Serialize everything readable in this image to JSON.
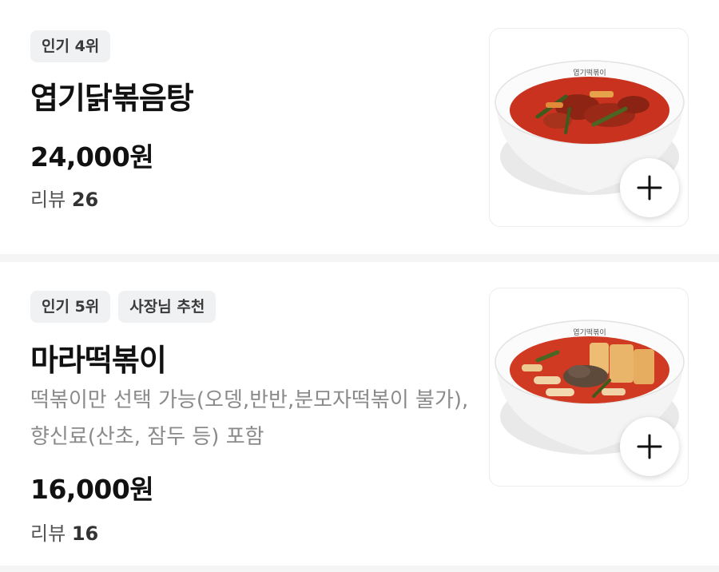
{
  "items": [
    {
      "badges": [
        "인기 4위"
      ],
      "name": "엽기닭볶음탕",
      "description": "",
      "price": "24,000원",
      "review_label": "리뷰",
      "review_count": "26",
      "image": "spicy-braised-chicken-bowl",
      "bowl_brand": "엽기떡볶이"
    },
    {
      "badges": [
        "인기 5위",
        "사장님 추천"
      ],
      "name": "마라떡볶이",
      "description": "떡볶이만 선택 가능(오뎅,반반,분모자떡볶이 불가), 향신료(산초, 잠두 등) 포함",
      "price": "16,000원",
      "review_label": "리뷰",
      "review_count": "16",
      "image": "mala-tteokbokki-bowl",
      "bowl_brand": "엽기떡볶이"
    }
  ],
  "add_icon": "plus-icon",
  "colors": {
    "badge_bg": "#f0f1f3",
    "sauce": "#c8321e",
    "separator": "#f5f5f5"
  }
}
